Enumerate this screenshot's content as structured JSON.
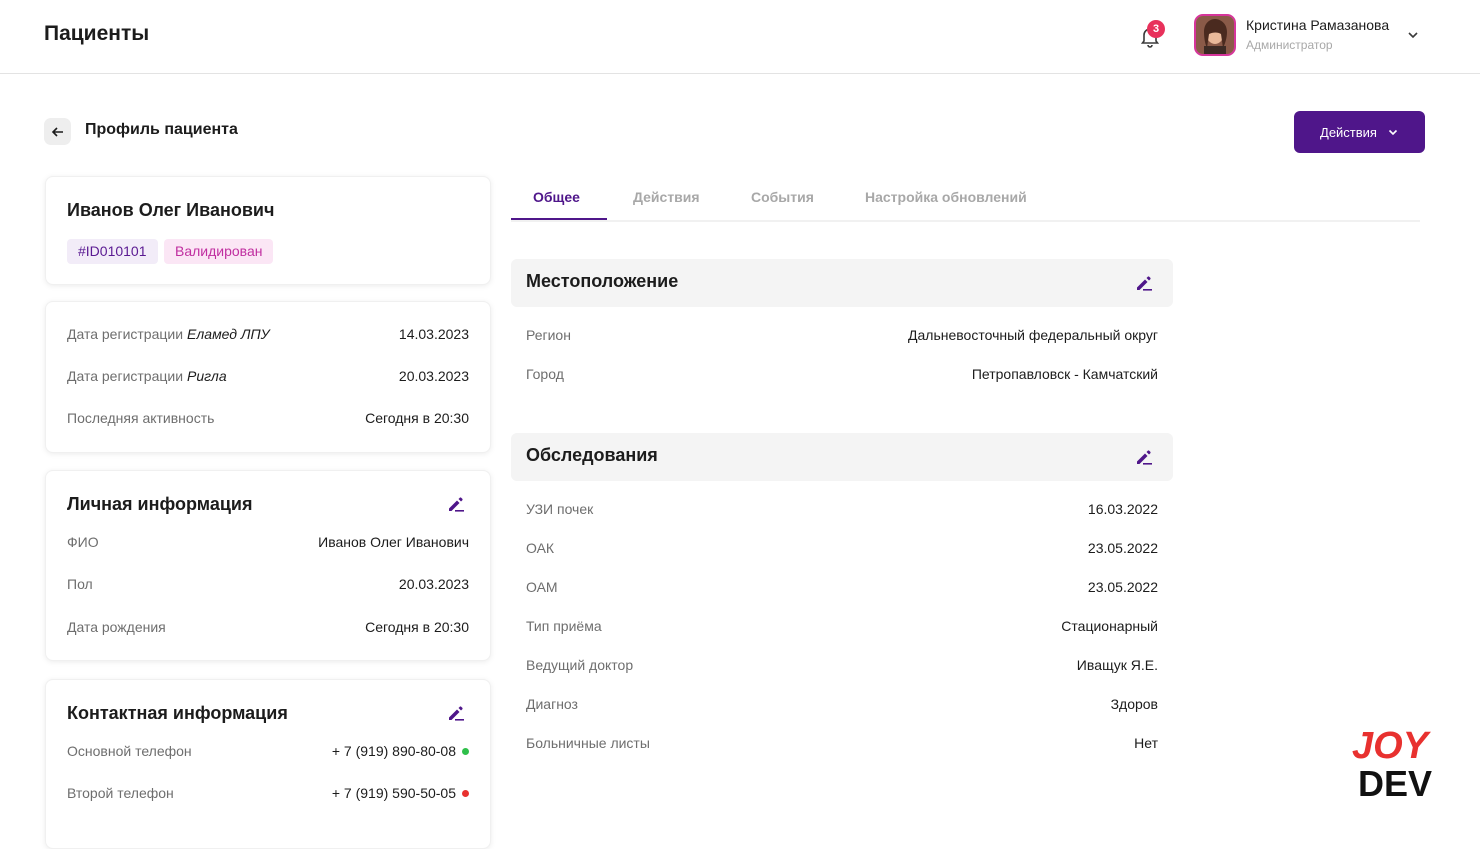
{
  "header": {
    "title": "Пациенты",
    "notifications_count": "3",
    "user_name": "Кристина Рамазанова",
    "user_role": "Администратор"
  },
  "page": {
    "heading": "Профиль пациента",
    "actions_label": "Действия"
  },
  "patient": {
    "name": "Иванов Олег Иванович",
    "id_tag": "#ID010101",
    "status_tag": "Валидирован"
  },
  "registration": [
    {
      "label": "Дата регистрации",
      "source": "Еламед ЛПУ",
      "value": "14.03.2023"
    },
    {
      "label": "Дата регистрации",
      "source": "Ригла",
      "value": "20.03.2023"
    },
    {
      "label": "Последняя активность",
      "source": "",
      "value": "Сегодня в 20:30"
    }
  ],
  "personal": {
    "title": "Личная информация",
    "rows": [
      {
        "label": "ФИО",
        "value": "Иванов Олег Иванович"
      },
      {
        "label": "Пол",
        "value": "20.03.2023"
      },
      {
        "label": "Дата рождения",
        "value": "Сегодня в 20:30"
      }
    ]
  },
  "contacts": {
    "title": "Контактная информация",
    "rows": [
      {
        "label": "Основной телефон",
        "value": "+ 7 (919) 890-80-08",
        "status_color": "#2fbf4a"
      },
      {
        "label": "Второй телефон",
        "value": "+ 7 (919) 590-50-05",
        "status_color": "#e8312f"
      }
    ]
  },
  "tabs": [
    {
      "label": "Общее",
      "active": true
    },
    {
      "label": "Действия",
      "active": false
    },
    {
      "label": "События",
      "active": false
    },
    {
      "label": "Настройка обновлений",
      "active": false
    }
  ],
  "location": {
    "title": "Местоположение",
    "rows": [
      {
        "label": "Регион",
        "value": "Дальневосточный федеральный округ"
      },
      {
        "label": "Город",
        "value": "Петропавловск - Камчатский"
      }
    ]
  },
  "exams": {
    "title": "Обследования",
    "rows": [
      {
        "label": "УЗИ почек",
        "value": "16.03.2022"
      },
      {
        "label": "ОАК",
        "value": "23.05.2022"
      },
      {
        "label": "ОАМ",
        "value": "23.05.2022"
      },
      {
        "label": "Тип приёма",
        "value": "Стационарный"
      },
      {
        "label": "Ведущий доктор",
        "value": "Ивaщук Я.Е."
      },
      {
        "label": "Диагноз",
        "value": "Здоров"
      },
      {
        "label": "Больничные листы",
        "value": "Нет"
      }
    ]
  },
  "logo": {
    "top": "JOY",
    "bottom": "DEV"
  },
  "colors": {
    "accent": "#4f168a",
    "pink": "#d6359b",
    "logo_red": "#e8312f"
  }
}
